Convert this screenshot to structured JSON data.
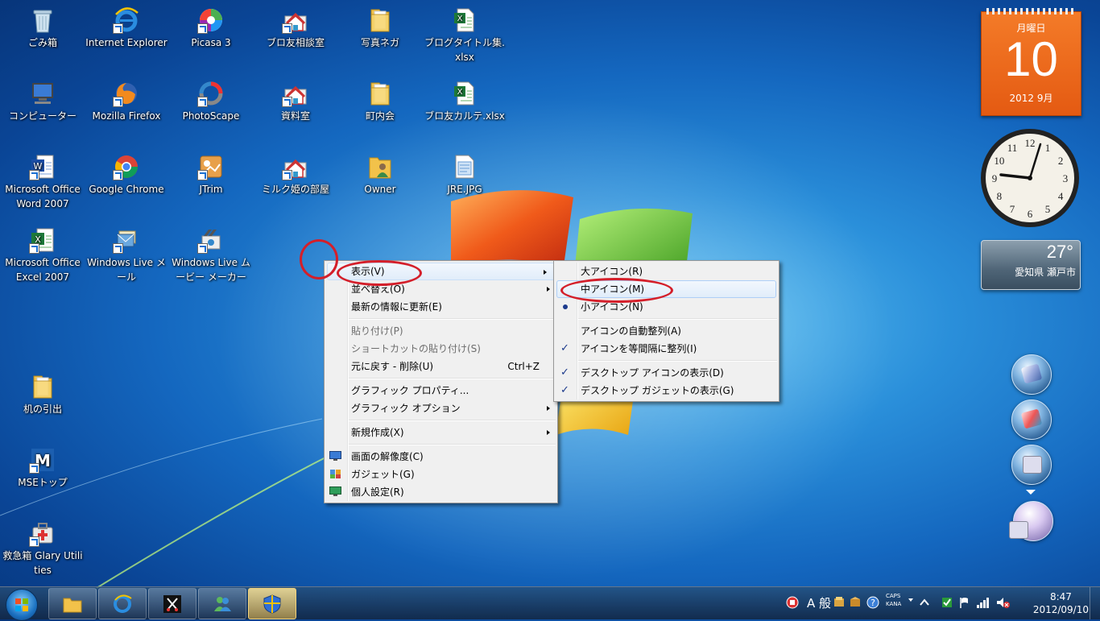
{
  "desktop_icons": [
    {
      "label": "ごみ箱",
      "icon": "recycle-bin-icon"
    },
    {
      "label": "Internet Explorer",
      "icon": "ie-icon"
    },
    {
      "label": "Picasa 3",
      "icon": "picasa-icon"
    },
    {
      "label": "ブロ友相談室",
      "icon": "house-folder-icon"
    },
    {
      "label": "写真ネガ",
      "icon": "folder-icon"
    },
    {
      "label": "ブログタイトル集.xlsx",
      "icon": "excel-file-icon"
    },
    {
      "label": "コンピューター",
      "icon": "computer-icon"
    },
    {
      "label": "Mozilla Firefox",
      "icon": "firefox-icon"
    },
    {
      "label": "PhotoScape",
      "icon": "photoscape-icon"
    },
    {
      "label": "資料室",
      "icon": "house-folder-icon"
    },
    {
      "label": "町内会",
      "icon": "folder-icon"
    },
    {
      "label": "ブロ友カルテ.xlsx",
      "icon": "excel-file-icon"
    },
    {
      "label": "Microsoft Office Word 2007",
      "icon": "word-icon"
    },
    {
      "label": "Google Chrome",
      "icon": "chrome-icon"
    },
    {
      "label": "JTrim",
      "icon": "jtrim-icon"
    },
    {
      "label": "ミルク姫の部屋",
      "icon": "house-folder-icon"
    },
    {
      "label": "Owner",
      "icon": "user-folder-icon"
    },
    {
      "label": "JRE.JPG",
      "icon": "image-file-icon"
    },
    {
      "label": "Microsoft Office Excel 2007",
      "icon": "excel-icon"
    },
    {
      "label": "Windows Live メール",
      "icon": "live-mail-icon"
    },
    {
      "label": "Windows Live ムービー メーカー",
      "icon": "movie-maker-icon"
    },
    {
      "label": "机の引出",
      "icon": "folder-icon"
    },
    {
      "label": "MSEトップ",
      "icon": "mse-icon"
    },
    {
      "label": "救急箱 Glary Utilities",
      "icon": "glary-icon"
    }
  ],
  "context_menu": {
    "items": [
      {
        "label": "表示(V)"
      },
      {
        "label": "並べ替え(O)"
      },
      {
        "label": "最新の情報に更新(E)"
      },
      {
        "label": "貼り付け(P)"
      },
      {
        "label": "ショートカットの貼り付け(S)"
      },
      {
        "label": "元に戻す - 削除(U)",
        "shortcut": "Ctrl+Z"
      },
      {
        "label": "グラフィック プロパティ..."
      },
      {
        "label": "グラフィック オプション"
      },
      {
        "label": "新規作成(X)"
      },
      {
        "label": "画面の解像度(C)"
      },
      {
        "label": "ガジェット(G)"
      },
      {
        "label": "個人設定(R)"
      }
    ]
  },
  "view_submenu": {
    "items": [
      {
        "label": "大アイコン(R)"
      },
      {
        "label": "中アイコン(M)"
      },
      {
        "label": "小アイコン(N)"
      },
      {
        "label": "アイコンの自動整列(A)"
      },
      {
        "label": "アイコンを等間隔に整列(I)"
      },
      {
        "label": "デスクトップ アイコンの表示(D)"
      },
      {
        "label": "デスクトップ ガジェットの表示(G)"
      }
    ]
  },
  "gadgets": {
    "calendar": {
      "weekday": "月曜日",
      "day": "10",
      "year_month": "2012 9月"
    },
    "clock": {
      "numerals": [
        "12",
        "1",
        "2",
        "3",
        "4",
        "5",
        "6",
        "7",
        "8",
        "9",
        "10",
        "11"
      ]
    },
    "weather": {
      "temp": "27°",
      "location": "愛知県 瀬戸市"
    }
  },
  "taskbar": {
    "ime_label": "A 般",
    "caps": "CAPS",
    "kana": "KANA",
    "time": "8:47",
    "date": "2012/09/10"
  },
  "colors": {
    "annotation": "#d41f2a",
    "calendar": "#f07020",
    "menu_check": "#1c3a8c"
  }
}
